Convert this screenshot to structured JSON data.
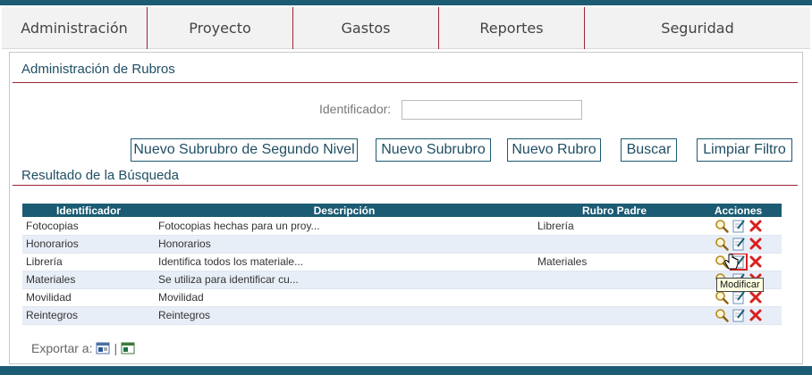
{
  "nav": {
    "items": [
      {
        "label": "Administración"
      },
      {
        "label": "Proyecto"
      },
      {
        "label": "Gastos"
      },
      {
        "label": "Reportes"
      },
      {
        "label": "Seguridad"
      }
    ]
  },
  "admin": {
    "title": "Administración de Rubros",
    "id_label": "Identificador:",
    "id_value": ""
  },
  "buttons": {
    "nuevo_subrubro_segundo": "Nuevo Subrubro de Segundo Nivel",
    "nuevo_subrubro": "Nuevo Subrubro",
    "nuevo_rubro": "Nuevo Rubro",
    "buscar": "Buscar",
    "limpiar": "Limpiar Filtro"
  },
  "results": {
    "title": "Resultado de la Búsqueda",
    "headers": [
      "Identificador",
      "Descripción",
      "Rubro Padre",
      "Acciones"
    ],
    "rows": [
      {
        "id": "Fotocopias",
        "desc": "Fotocopias hechas para un proy...",
        "parent": "Librería"
      },
      {
        "id": "Honorarios",
        "desc": "Honorarios",
        "parent": ""
      },
      {
        "id": "Librería",
        "desc": "Identifica todos los materiale...",
        "parent": "Materiales"
      },
      {
        "id": "Materiales",
        "desc": "Se utiliza para identificar cu...",
        "parent": ""
      },
      {
        "id": "Movilidad",
        "desc": "Movilidad",
        "parent": ""
      },
      {
        "id": "Reintegros",
        "desc": "Reintegros",
        "parent": ""
      }
    ]
  },
  "export": {
    "label": "Exportar a:",
    "separator": "|"
  },
  "tooltip": "Modificar",
  "icons": {
    "view": "magnifier-icon",
    "edit": "edit-icon",
    "delete": "delete-icon",
    "word": "word-export-icon",
    "excel": "excel-export-icon"
  },
  "colors": {
    "accent": "#1b5b73",
    "divider": "#9b2335",
    "row_alt": "#e8eef7",
    "delete": "#d9201e"
  }
}
